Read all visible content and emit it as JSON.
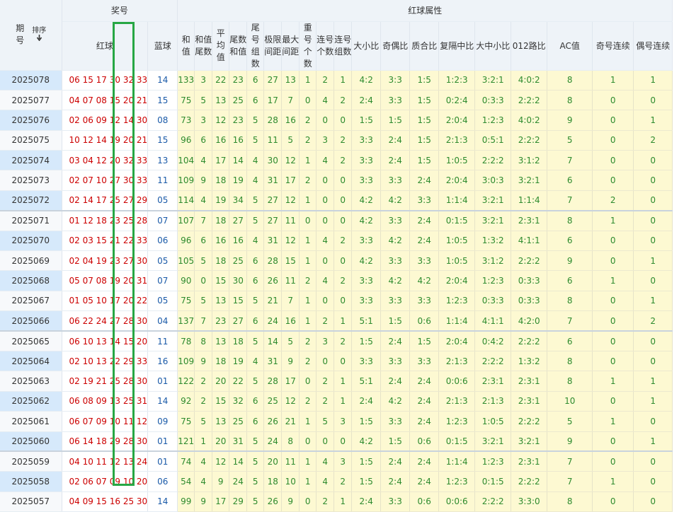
{
  "header": {
    "issue_label": "期号",
    "sort_label": "排序",
    "sort_icon": "arrow-down",
    "prize_label": "奖号",
    "red_label": "红球",
    "blue_label": "蓝球",
    "attr_label": "红球属性",
    "columns": [
      "和值",
      "和值尾数",
      "平均值",
      "尾数和值",
      "尾号组数",
      "极限间距",
      "最大间距",
      "重号个数",
      "连号个数",
      "连号组数",
      "大小比",
      "奇偶比",
      "质合比",
      "复隔中比",
      "大中小比",
      "012路比",
      "AC值",
      "奇号连续",
      "偶号连续"
    ]
  },
  "highlight_color": "#27a744",
  "rows": [
    {
      "issue": "2025078",
      "red": "06 15 17 30 32 33",
      "blue": "14",
      "attrs": [
        "133",
        "3",
        "22",
        "23",
        "6",
        "27",
        "13",
        "1",
        "2",
        "1",
        "4:2",
        "3:3",
        "1:5",
        "1:2:3",
        "3:2:1",
        "4:0:2",
        "8",
        "1",
        "1"
      ]
    },
    {
      "issue": "2025077",
      "red": "04 07 08 15 20 21",
      "blue": "15",
      "attrs": [
        "75",
        "5",
        "13",
        "25",
        "6",
        "17",
        "7",
        "0",
        "4",
        "2",
        "2:4",
        "3:3",
        "1:5",
        "0:2:4",
        "0:3:3",
        "2:2:2",
        "8",
        "0",
        "0"
      ]
    },
    {
      "issue": "2025076",
      "red": "02 06 09 12 14 30",
      "blue": "08",
      "attrs": [
        "73",
        "3",
        "12",
        "23",
        "5",
        "28",
        "16",
        "2",
        "0",
        "0",
        "1:5",
        "1:5",
        "1:5",
        "2:0:4",
        "1:2:3",
        "4:0:2",
        "9",
        "0",
        "1"
      ]
    },
    {
      "issue": "2025075",
      "red": "10 12 14 19 20 21",
      "blue": "15",
      "attrs": [
        "96",
        "6",
        "16",
        "16",
        "5",
        "11",
        "5",
        "2",
        "3",
        "2",
        "3:3",
        "2:4",
        "1:5",
        "2:1:3",
        "0:5:1",
        "2:2:2",
        "5",
        "0",
        "2"
      ]
    },
    {
      "issue": "2025074",
      "red": "03 04 12 20 32 33",
      "blue": "13",
      "attrs": [
        "104",
        "4",
        "17",
        "14",
        "4",
        "30",
        "12",
        "1",
        "4",
        "2",
        "3:3",
        "2:4",
        "1:5",
        "1:0:5",
        "2:2:2",
        "3:1:2",
        "7",
        "0",
        "0"
      ]
    },
    {
      "issue": "2025073",
      "red": "02 07 10 27 30 33",
      "blue": "11",
      "attrs": [
        "109",
        "9",
        "18",
        "19",
        "4",
        "31",
        "17",
        "2",
        "0",
        "0",
        "3:3",
        "3:3",
        "2:4",
        "2:0:4",
        "3:0:3",
        "3:2:1",
        "6",
        "0",
        "0"
      ]
    },
    {
      "issue": "2025072",
      "red": "02 14 17 25 27 29",
      "blue": "05",
      "attrs": [
        "114",
        "4",
        "19",
        "34",
        "5",
        "27",
        "12",
        "1",
        "0",
        "0",
        "4:2",
        "4:2",
        "3:3",
        "1:1:4",
        "3:2:1",
        "1:1:4",
        "7",
        "2",
        "0"
      ]
    },
    {
      "issue": "2025071",
      "red": "01 12 18 23 25 28",
      "blue": "07",
      "attrs": [
        "107",
        "7",
        "18",
        "27",
        "5",
        "27",
        "11",
        "0",
        "0",
        "0",
        "4:2",
        "3:3",
        "2:4",
        "0:1:5",
        "3:2:1",
        "2:3:1",
        "8",
        "1",
        "0"
      ]
    },
    {
      "issue": "2025070",
      "red": "02 03 15 21 22 33",
      "blue": "06",
      "attrs": [
        "96",
        "6",
        "16",
        "16",
        "4",
        "31",
        "12",
        "1",
        "4",
        "2",
        "3:3",
        "4:2",
        "2:4",
        "1:0:5",
        "1:3:2",
        "4:1:1",
        "6",
        "0",
        "0"
      ]
    },
    {
      "issue": "2025069",
      "red": "02 04 19 23 27 30",
      "blue": "05",
      "attrs": [
        "105",
        "5",
        "18",
        "25",
        "6",
        "28",
        "15",
        "1",
        "0",
        "0",
        "4:2",
        "3:3",
        "3:3",
        "1:0:5",
        "3:1:2",
        "2:2:2",
        "9",
        "0",
        "1"
      ]
    },
    {
      "issue": "2025068",
      "red": "05 07 08 19 20 31",
      "blue": "07",
      "attrs": [
        "90",
        "0",
        "15",
        "30",
        "6",
        "26",
        "11",
        "2",
        "4",
        "2",
        "3:3",
        "4:2",
        "4:2",
        "2:0:4",
        "1:2:3",
        "0:3:3",
        "6",
        "1",
        "0"
      ]
    },
    {
      "issue": "2025067",
      "red": "01 05 10 17 20 22",
      "blue": "05",
      "attrs": [
        "75",
        "5",
        "13",
        "15",
        "5",
        "21",
        "7",
        "1",
        "0",
        "0",
        "3:3",
        "3:3",
        "3:3",
        "1:2:3",
        "0:3:3",
        "0:3:3",
        "8",
        "0",
        "1"
      ]
    },
    {
      "issue": "2025066",
      "red": "06 22 24 27 28 30",
      "blue": "04",
      "attrs": [
        "137",
        "7",
        "23",
        "27",
        "6",
        "24",
        "16",
        "1",
        "2",
        "1",
        "5:1",
        "1:5",
        "0:6",
        "1:1:4",
        "4:1:1",
        "4:2:0",
        "7",
        "0",
        "2"
      ]
    },
    {
      "issue": "2025065",
      "red": "06 10 13 14 15 20",
      "blue": "11",
      "attrs": [
        "78",
        "8",
        "13",
        "18",
        "5",
        "14",
        "5",
        "2",
        "3",
        "2",
        "1:5",
        "2:4",
        "1:5",
        "2:0:4",
        "0:4:2",
        "2:2:2",
        "6",
        "0",
        "0"
      ]
    },
    {
      "issue": "2025064",
      "red": "02 10 13 22 29 33",
      "blue": "16",
      "attrs": [
        "109",
        "9",
        "18",
        "19",
        "4",
        "31",
        "9",
        "2",
        "0",
        "0",
        "3:3",
        "3:3",
        "3:3",
        "2:1:3",
        "2:2:2",
        "1:3:2",
        "8",
        "0",
        "0"
      ]
    },
    {
      "issue": "2025063",
      "red": "02 19 21 25 28 30",
      "blue": "01",
      "attrs": [
        "122",
        "2",
        "20",
        "22",
        "5",
        "28",
        "17",
        "0",
        "2",
        "1",
        "5:1",
        "2:4",
        "2:4",
        "0:0:6",
        "2:3:1",
        "2:3:1",
        "8",
        "1",
        "1"
      ]
    },
    {
      "issue": "2025062",
      "red": "06 08 09 13 25 31",
      "blue": "14",
      "attrs": [
        "92",
        "2",
        "15",
        "32",
        "6",
        "25",
        "12",
        "2",
        "2",
        "1",
        "2:4",
        "4:2",
        "2:4",
        "2:1:3",
        "2:1:3",
        "2:3:1",
        "10",
        "0",
        "1"
      ]
    },
    {
      "issue": "2025061",
      "red": "06 07 09 10 11 12",
      "blue": "09",
      "attrs": [
        "75",
        "5",
        "13",
        "25",
        "6",
        "26",
        "21",
        "1",
        "5",
        "3",
        "1:5",
        "3:3",
        "2:4",
        "1:2:3",
        "1:0:5",
        "2:2:2",
        "5",
        "1",
        "0"
      ]
    },
    {
      "issue": "2025060",
      "red": "06 14 18 29 28 30",
      "blue": "01",
      "attrs": [
        "121",
        "1",
        "20",
        "31",
        "5",
        "24",
        "8",
        "0",
        "0",
        "0",
        "4:2",
        "1:5",
        "0:6",
        "0:1:5",
        "3:2:1",
        "3:2:1",
        "9",
        "0",
        "1"
      ]
    },
    {
      "issue": "2025059",
      "red": "04 10 11 12 13 24",
      "blue": "01",
      "attrs": [
        "74",
        "4",
        "12",
        "14",
        "5",
        "20",
        "11",
        "1",
        "4",
        "3",
        "1:5",
        "2:4",
        "2:4",
        "1:1:4",
        "1:2:3",
        "2:3:1",
        "7",
        "0",
        "0"
      ]
    },
    {
      "issue": "2025058",
      "red": "02 06 07 09 10 20",
      "blue": "06",
      "attrs": [
        "54",
        "4",
        "9",
        "24",
        "5",
        "18",
        "10",
        "1",
        "4",
        "2",
        "1:5",
        "2:4",
        "2:4",
        "1:2:3",
        "0:1:5",
        "2:2:2",
        "7",
        "1",
        "0"
      ]
    },
    {
      "issue": "2025057",
      "red": "04 09 15 16 25 30",
      "blue": "14",
      "attrs": [
        "99",
        "9",
        "17",
        "29",
        "5",
        "26",
        "9",
        "0",
        "2",
        "1",
        "2:4",
        "3:3",
        "0:6",
        "0:0:6",
        "2:2:2",
        "3:3:0",
        "8",
        "0",
        "0"
      ]
    }
  ]
}
